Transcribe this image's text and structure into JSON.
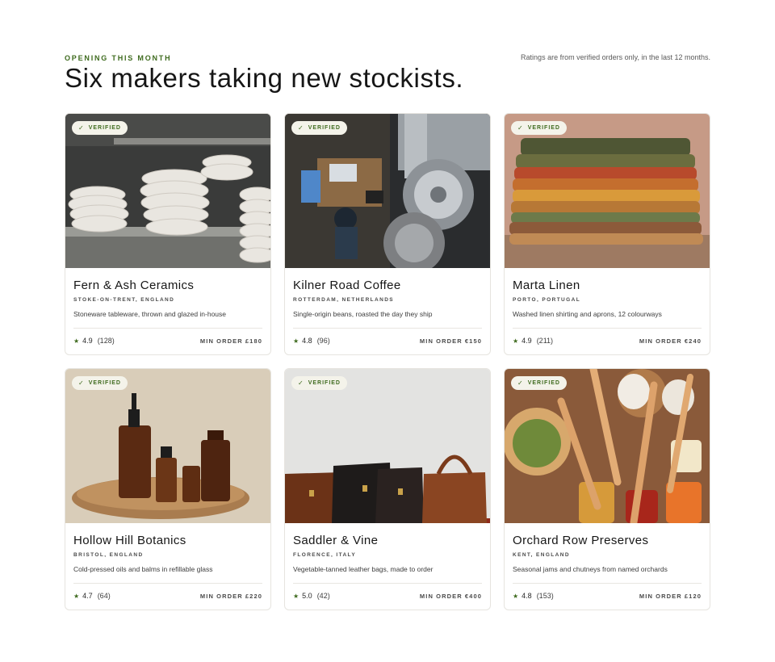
{
  "header": {
    "eyebrow": "OPENING THIS MONTH",
    "title": "Six makers taking new stockists.",
    "ratings_note": "Ratings are from verified orders only, in the last 12 months."
  },
  "badge_label": "VERIFIED",
  "cards": [
    {
      "name": "Fern & Ash Ceramics",
      "location": "STOKE-ON-TRENT, ENGLAND",
      "description": "Stoneware tableware, thrown and glazed in-house",
      "rating": "4.9",
      "reviews": "(128)",
      "min_order": "MIN ORDER £180",
      "photo": "stacked-ceramic-bowls-photo"
    },
    {
      "name": "Kilner Road Coffee",
      "location": "ROTTERDAM, NETHERLANDS",
      "description": "Single-origin beans, roasted the day they ship",
      "rating": "4.8",
      "reviews": "(96)",
      "min_order": "MIN ORDER €150",
      "photo": "coffee-roaster-workshop-photo"
    },
    {
      "name": "Marta Linen",
      "location": "PORTO, PORTUGAL",
      "description": "Washed linen shirting and aprons, 12 colourways",
      "rating": "4.9",
      "reviews": "(211)",
      "min_order": "MIN ORDER €240",
      "photo": "folded-linen-stack-photo"
    },
    {
      "name": "Hollow Hill Botanics",
      "location": "BRISTOL, ENGLAND",
      "description": "Cold-pressed oils and balms in refillable glass",
      "rating": "4.7",
      "reviews": "(64)",
      "min_order": "MIN ORDER £220",
      "photo": "amber-glass-bottles-photo"
    },
    {
      "name": "Saddler & Vine",
      "location": "FLORENCE, ITALY",
      "description": "Vegetable-tanned leather bags, made to order",
      "rating": "5.0",
      "reviews": "(42)",
      "min_order": "MIN ORDER €400",
      "photo": "leather-bags-photo"
    },
    {
      "name": "Orchard Row Preserves",
      "location": "KENT, ENGLAND",
      "description": "Seasonal jams and chutneys from named orchards",
      "rating": "4.8",
      "reviews": "(153)",
      "min_order": "MIN ORDER £120",
      "photo": "jam-jars-wooden-spoons-photo"
    }
  ],
  "colors": {
    "accent": "#3f6b1f",
    "badge_bg": "#f4f3ea",
    "border": "#e6e4df"
  },
  "icons": {
    "check": "check-icon",
    "star": "star-icon"
  }
}
